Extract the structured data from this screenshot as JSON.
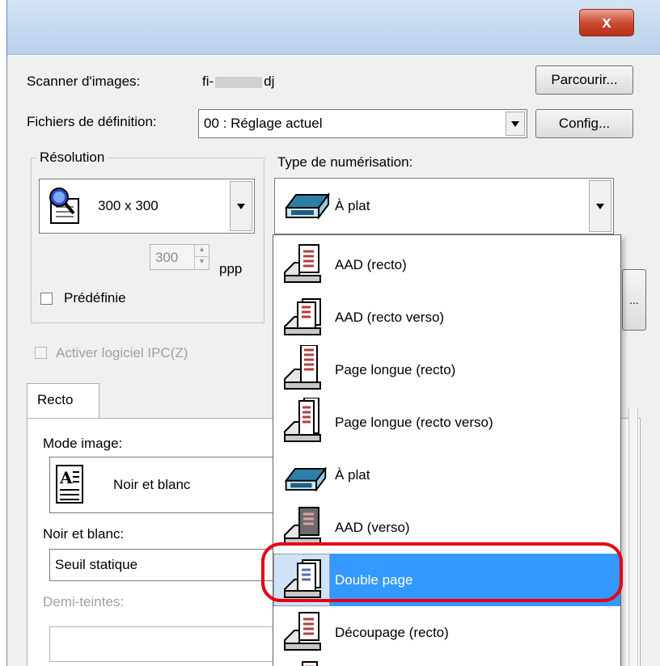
{
  "window": {
    "close_label": "x"
  },
  "scanner": {
    "label": "Scanner d'images:",
    "value_prefix": "fi-",
    "value_suffix": "dj",
    "browse_label": "Parcourir..."
  },
  "definition": {
    "label": "Fichiers de définition:",
    "value": "00 : Réglage actuel",
    "config_label": "Config..."
  },
  "resolution": {
    "group_title": "Résolution",
    "value": "300 x 300",
    "dpi_value": "300",
    "dpi_unit": "ppp",
    "predefined_label": "Prédéfinie"
  },
  "scan_type": {
    "label": "Type de numérisation:",
    "value": "À plat",
    "side_button_label": "..."
  },
  "ipc": {
    "label": "Activer logiciel IPC(Z)"
  },
  "tabs": {
    "recto_label": "Recto"
  },
  "image_mode": {
    "label": "Mode image:",
    "value": "Noir et blanc"
  },
  "bw": {
    "label": "Noir et blanc:",
    "value": "Seuil statique"
  },
  "halftone": {
    "label": "Demi-teintes:",
    "value": ""
  },
  "dropdown": {
    "items": [
      {
        "label": "AAD (recto)",
        "icon": "adf-simplex-icon"
      },
      {
        "label": "AAD (recto verso)",
        "icon": "adf-duplex-icon"
      },
      {
        "label": "Page longue (recto)",
        "icon": "long-page-simplex-icon"
      },
      {
        "label": "Page longue (recto verso)",
        "icon": "long-page-duplex-icon"
      },
      {
        "label": "À plat",
        "icon": "flatbed-icon"
      },
      {
        "label": "AAD (verso)",
        "icon": "adf-back-icon"
      },
      {
        "label": "Double page",
        "icon": "double-page-icon",
        "selected": true
      },
      {
        "label": "Découpage (recto)",
        "icon": "cropping-simplex-icon"
      }
    ]
  },
  "colors": {
    "selection": "#3399ff",
    "highlight_ring": "#e60012",
    "close_button": "#c9462c"
  }
}
